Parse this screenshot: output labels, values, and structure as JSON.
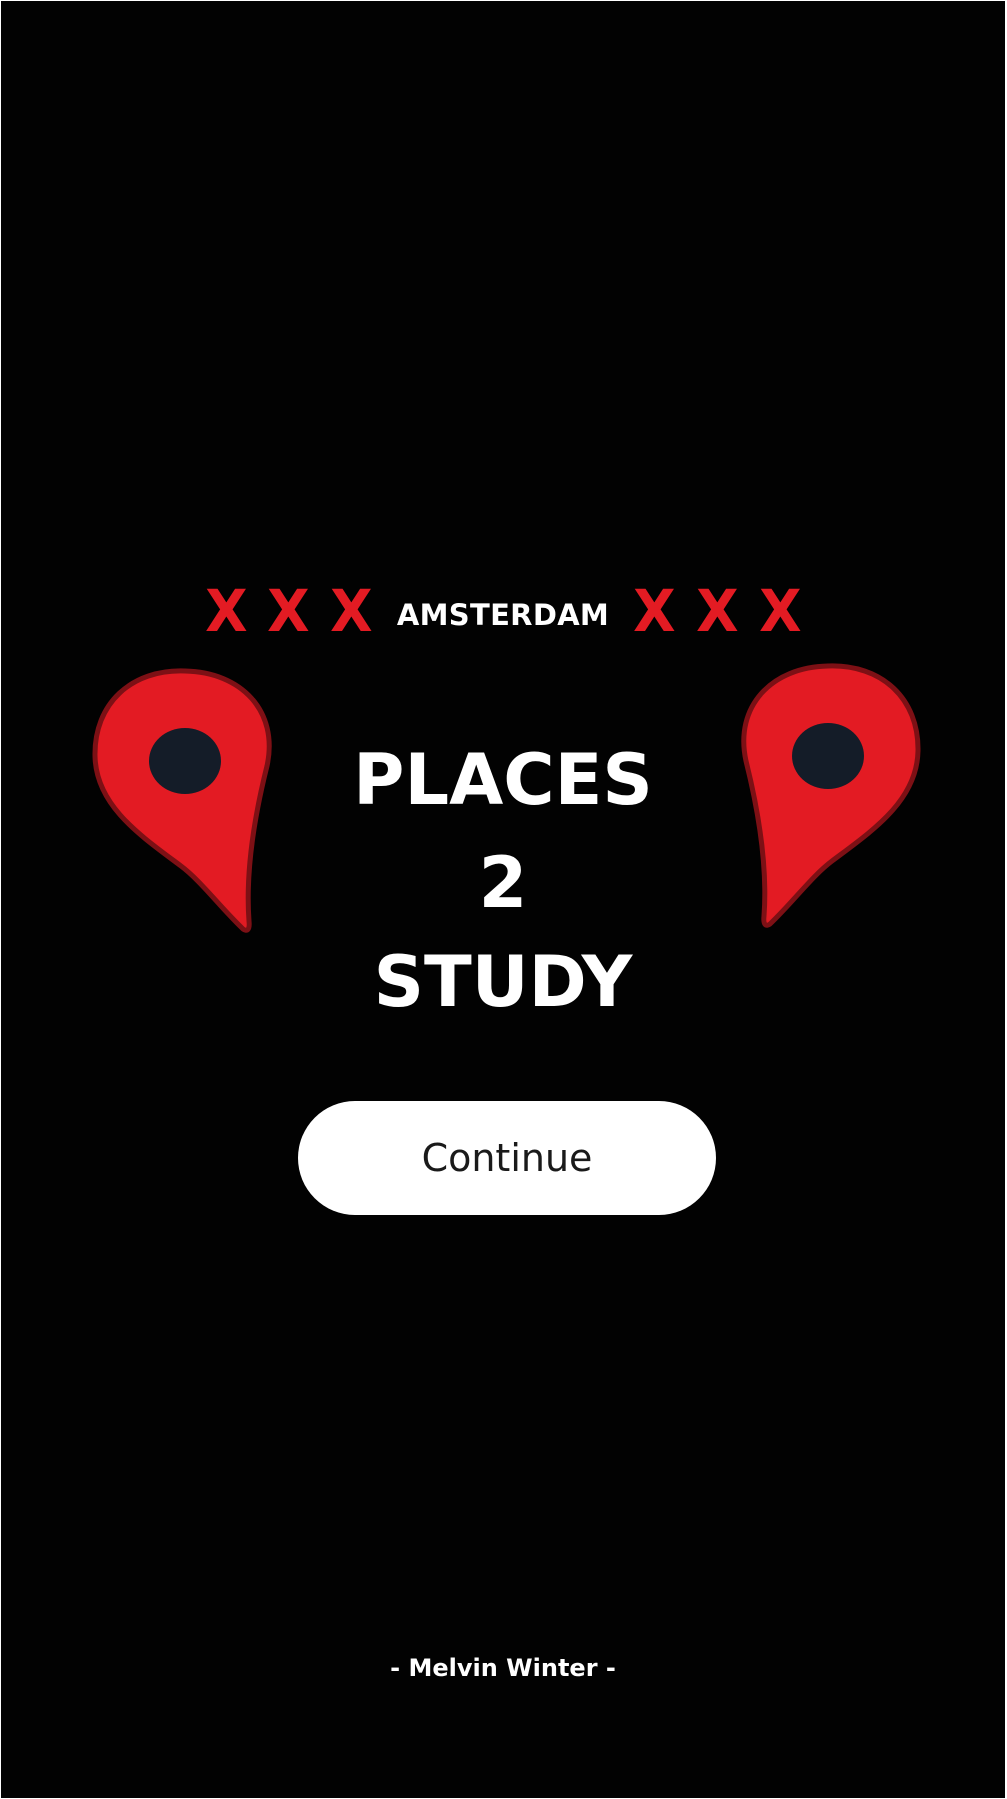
{
  "header": {
    "marks_left": [
      "X",
      "X",
      "X"
    ],
    "city": "AMSTERDAM",
    "marks_right": [
      "X",
      "X",
      "X"
    ]
  },
  "title": {
    "line1": "PLACES",
    "line2": "2",
    "line3": "STUDY"
  },
  "continue_label": "Continue",
  "credit": "- Melvin Winter -",
  "icons": {
    "pin_left": "map-pin-icon",
    "pin_right": "map-pin-icon"
  },
  "colors": {
    "background": "#020202",
    "accent_red": "#e31b23",
    "pin_center": "#141c28",
    "text": "#ffffff"
  }
}
